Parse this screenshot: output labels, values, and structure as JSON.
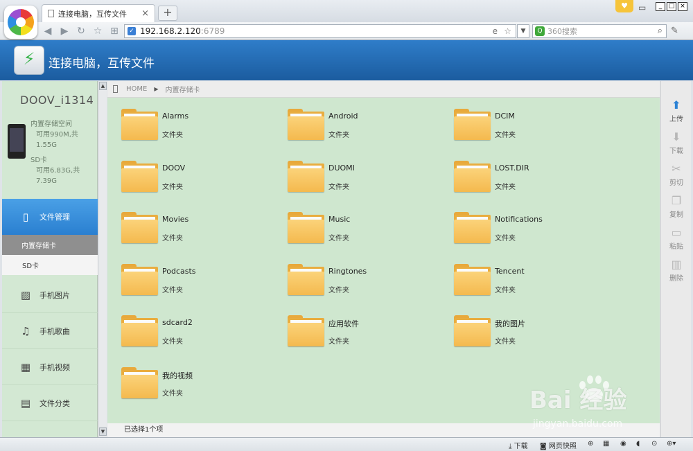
{
  "browser": {
    "tab_title": "连接电脑，互传文件",
    "tab_close": "×",
    "new_tab": "+",
    "address_host": "192.168.2.120",
    "address_port": ":6789",
    "search_placeholder": "360搜索",
    "status_items": {
      "download": "下载",
      "snapshot": "网页快照"
    }
  },
  "app": {
    "title": "连接电脑，互传文件",
    "device_name": "DOOV_i1314",
    "internal_storage": {
      "label": "内置存储空间",
      "available": "可用990M,共",
      "total": "1.55G"
    },
    "sd_storage": {
      "label": "SD卡",
      "available": "可用6.83G,共",
      "total": "7.39G"
    },
    "nav": {
      "file_manager": "文件管理",
      "internal": "内置存储卡",
      "sd": "SD卡",
      "photos": "手机图片",
      "music": "手机歌曲",
      "video": "手机视频",
      "category": "文件分类"
    },
    "breadcrumb": {
      "home": "HOME",
      "current": "内置存储卡"
    },
    "folders": [
      {
        "name": "Alarms",
        "type": "文件夹"
      },
      {
        "name": "Android",
        "type": "文件夹"
      },
      {
        "name": "DCIM",
        "type": "文件夹"
      },
      {
        "name": "DOOV",
        "type": "文件夹"
      },
      {
        "name": "DUOMI",
        "type": "文件夹"
      },
      {
        "name": "LOST.DIR",
        "type": "文件夹"
      },
      {
        "name": "Movies",
        "type": "文件夹"
      },
      {
        "name": "Music",
        "type": "文件夹"
      },
      {
        "name": "Notifications",
        "type": "文件夹"
      },
      {
        "name": "Podcasts",
        "type": "文件夹"
      },
      {
        "name": "Ringtones",
        "type": "文件夹"
      },
      {
        "name": "Tencent",
        "type": "文件夹"
      },
      {
        "name": "sdcard2",
        "type": "文件夹"
      },
      {
        "name": "应用软件",
        "type": "文件夹"
      },
      {
        "name": "我的图片",
        "type": "文件夹"
      },
      {
        "name": "我的视频",
        "type": "文件夹"
      }
    ],
    "selection_status": "已选择1个项",
    "actions": {
      "upload": "上传",
      "download": "下载",
      "cut": "剪切",
      "copy": "复制",
      "paste": "粘贴",
      "delete": "删除"
    }
  },
  "watermark": {
    "brand": "Bai  经验",
    "url": "jingyan.baidu.com"
  }
}
